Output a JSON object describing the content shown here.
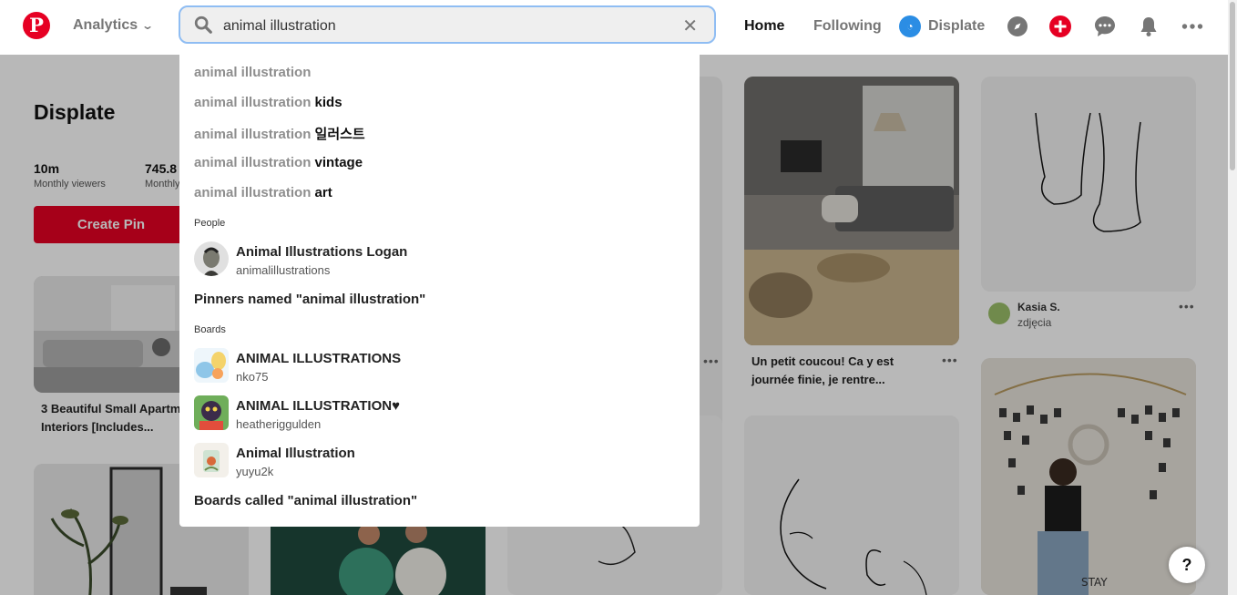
{
  "header": {
    "logo_letter": "P",
    "analytics_label": "Analytics",
    "search": {
      "value": "animal illustration"
    },
    "nav": {
      "home": "Home",
      "following": "Following",
      "displate": "Displate"
    }
  },
  "profile": {
    "name": "Displate",
    "stats": [
      {
        "value": "10m",
        "label": "Monthly viewers"
      },
      {
        "value": "745.8",
        "label": "Monthly"
      }
    ],
    "create_pin": "Create Pin"
  },
  "pins": [
    {
      "caption_line1": "3 Beautiful Small Apartm",
      "caption_line2": "Interiors [Includes..."
    },
    {
      "caption_line1": "Un petit coucou! Ca y est",
      "caption_line2": "journée finie, je rentre..."
    },
    {
      "user": "Kasia S.",
      "board": "zdjęcia"
    }
  ],
  "dropdown": {
    "query": "animal illustration",
    "suggestions": [
      {
        "suffix": ""
      },
      {
        "suffix": " kids"
      },
      {
        "suffix": " 일러스트"
      },
      {
        "suffix": " vintage"
      },
      {
        "suffix": " art"
      }
    ],
    "people_label": "People",
    "people": [
      {
        "name": "Animal Illustrations Logan",
        "username": "animalillustrations"
      }
    ],
    "pinners_link": "Pinners named \"animal illustration\"",
    "boards_label": "Boards",
    "boards": [
      {
        "name": "ANIMAL ILLUSTRATIONS",
        "owner": "nko75"
      },
      {
        "name": "ANIMAL ILLUSTRATION♥",
        "owner": "heatheriggulden"
      },
      {
        "name": "Animal Illustration",
        "owner": "yuyu2k"
      }
    ],
    "boards_link": "Boards called \"animal illustration\""
  },
  "help_label": "?"
}
